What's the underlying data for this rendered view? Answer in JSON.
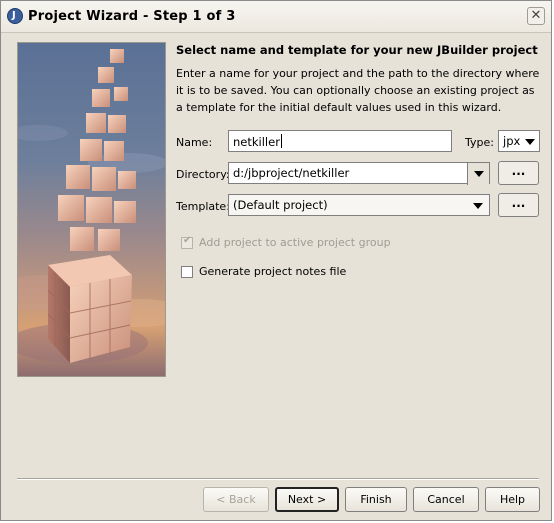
{
  "window": {
    "title": "Project Wizard - Step 1 of 3"
  },
  "main": {
    "heading": "Select name and template for your new JBuilder project",
    "description": "Enter a name for your project and the path to the directory where it is to be saved. You can optionally choose an existing project as a template for the initial default values used in this wizard."
  },
  "form": {
    "name_label": "Name:",
    "name_value": "netkiller",
    "type_label": "Type:",
    "type_value": "jpx",
    "directory_label": "Directory:",
    "directory_value": "d:/jbproject/netkiller",
    "template_label": "Template:",
    "template_value": "(Default project)",
    "browse_label": "..."
  },
  "options": {
    "add_to_group_label": "Add project to active project group",
    "add_to_group_checked": true,
    "add_to_group_enabled": false,
    "notes_label": "Generate project notes file",
    "notes_checked": false
  },
  "buttons": {
    "back": "< Back",
    "next": "Next >",
    "finish": "Finish",
    "cancel": "Cancel",
    "help": "Help"
  },
  "icons": [
    "jbuilder-app-icon",
    "close-icon",
    "dropdown-arrow-icon"
  ]
}
